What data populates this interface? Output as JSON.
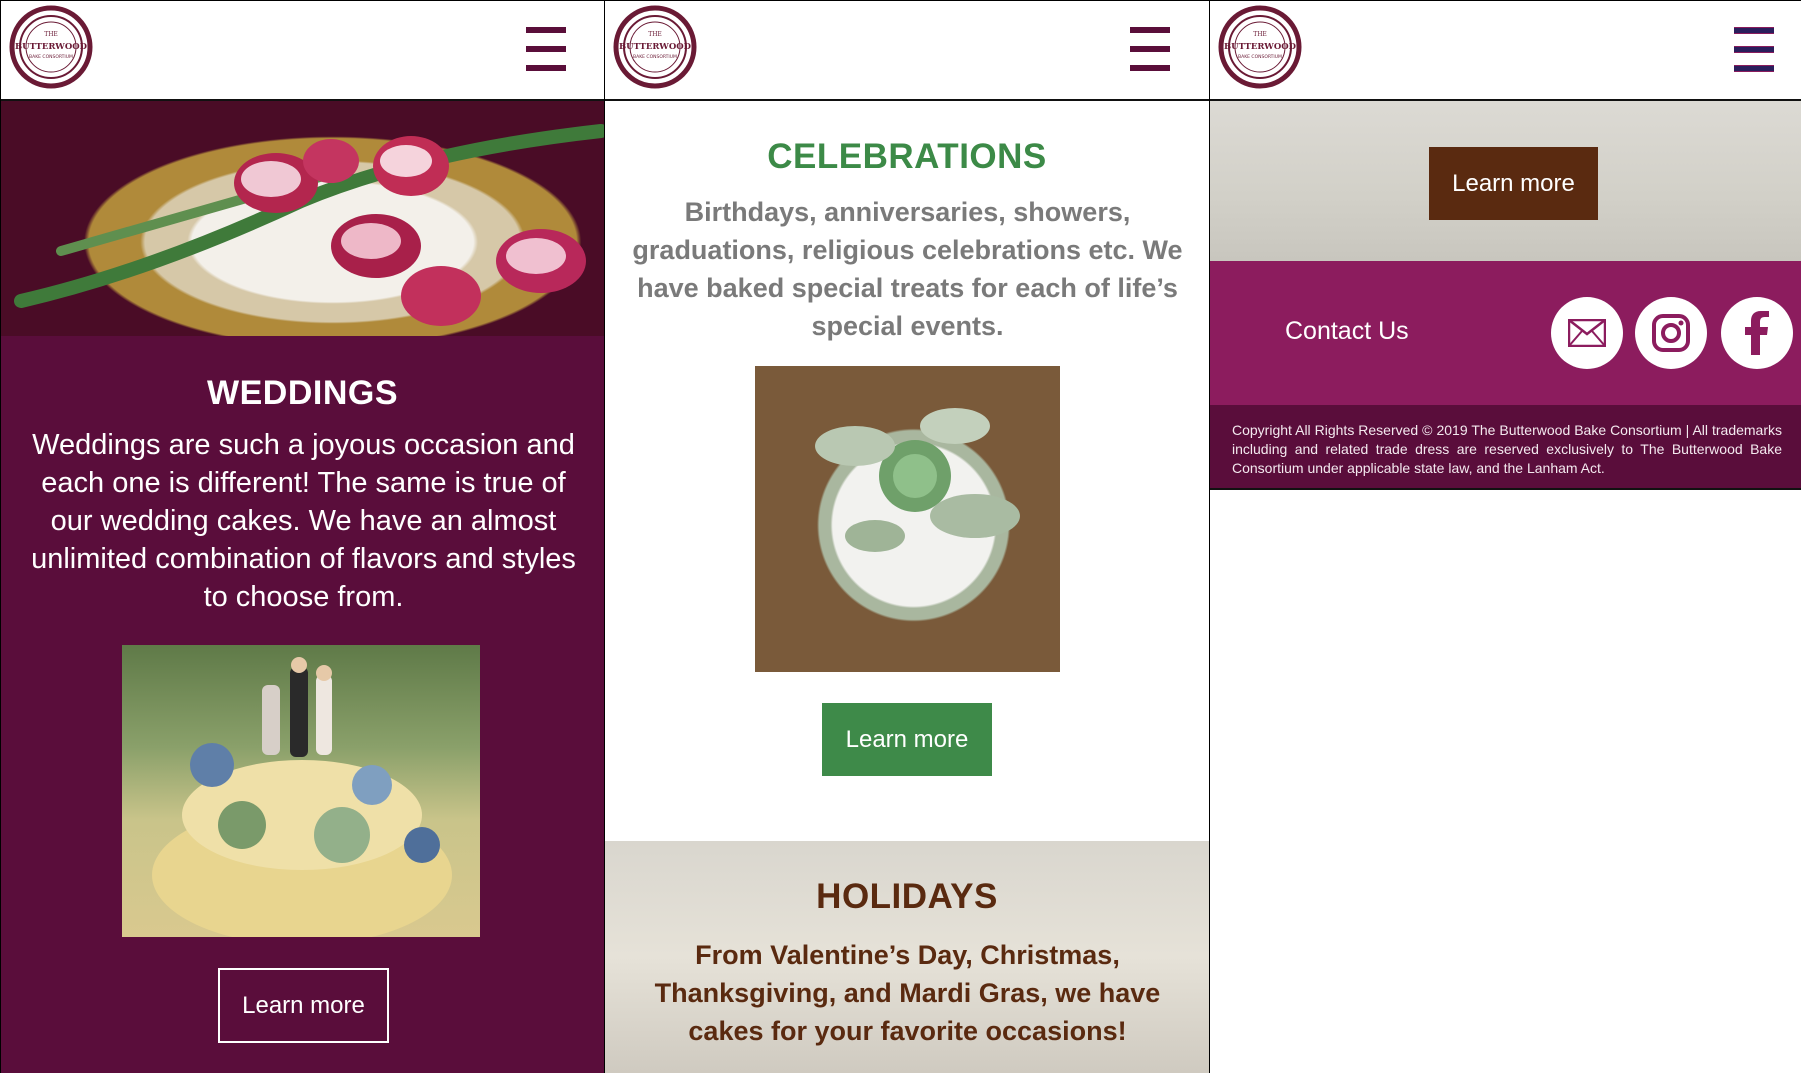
{
  "brand": {
    "logo_top": "THE",
    "logo_name": "BUTTERWOOD",
    "logo_bottom": "BAKE CONSORTIUM",
    "colors": {
      "plum": "#5a0d3b",
      "magenta": "#8c1c5e",
      "green": "#3e8a49",
      "brown": "#5a2a10",
      "gray_text": "#7a7a7a"
    }
  },
  "menu": {
    "icon": "hamburger-menu-icon"
  },
  "weddings": {
    "title": "WEDDINGS",
    "text": "Weddings are such a joyous occasion and each one is different! The same is true of our wedding cakes. We have an almost unlimited combination of flavors and styles to choose from.",
    "button": "Learn more"
  },
  "celebrations": {
    "title": "CELEBRATIONS",
    "text": "Birthdays, anniversaries, showers, graduations, religious celebrations etc. We have baked special treats for each of life’s special events.",
    "button": "Learn more"
  },
  "holidays": {
    "title": "HOLIDAYS",
    "text": "From Valentine’s Day, Christmas, Thanksgiving, and Mardi Gras, we have cakes for your favorite occasions!",
    "button": "Learn more"
  },
  "footer": {
    "contact": "Contact Us",
    "social_icons": [
      "mail-icon",
      "instagram-icon",
      "facebook-icon"
    ],
    "copyright": "Copyright All Rights Reserved © 2019 The Butterwood Bake Consortium | All trademarks including and related trade dress are reserved exclusively to The Butterwood Bake Consortium under applicable state law, and the Lanham Act."
  }
}
